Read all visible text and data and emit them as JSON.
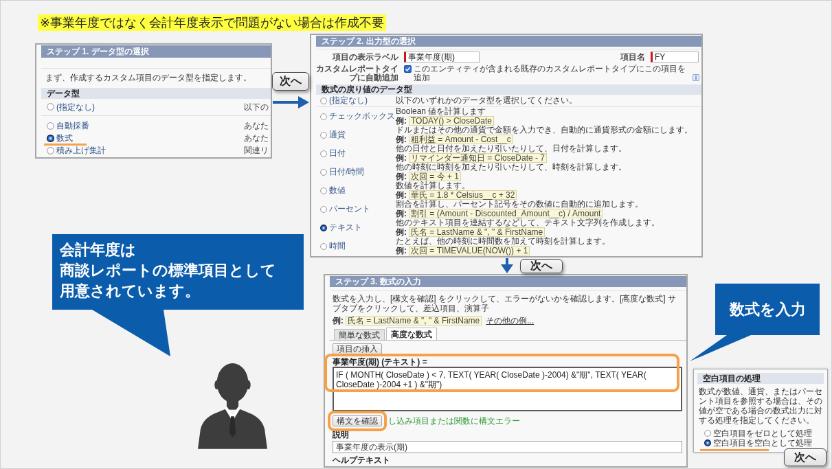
{
  "note": {
    "text": "※事業年度ではなく会計年度表示で問題がない場合は作成不要"
  },
  "step1": {
    "title": "ステップ 1. データ型の選択",
    "intro": "まず、作成するカスタム項目のデータ型を指定します。",
    "section": "データ型",
    "options": [
      {
        "label": "(指定なし)",
        "description": "以下の",
        "selected": false
      },
      {
        "label": "自動採番",
        "description": "あなた",
        "selected": false
      },
      {
        "label": "数式",
        "description": "あなた",
        "selected": true
      },
      {
        "label": "積み上げ集計",
        "description": "関連リ",
        "selected": false
      }
    ]
  },
  "step2": {
    "title": "ステップ 2. 出力型の選択",
    "fields": [
      {
        "label": "項目の表示ラベル",
        "value": "事業年度(期)"
      },
      {
        "label": "項目名",
        "value": "FY"
      }
    ],
    "auto_add": {
      "label": "カスタムレポートタイプに自動追加",
      "checked": true,
      "text": "このエンティティが含まれる既存のカスタムレポートタイプにこの項目を追加"
    },
    "section": "数式の戻り値のデータ型",
    "options": [
      {
        "label": "(指定なし)",
        "selected": false,
        "description": "以下のいずれかのデータ型を選択してください。"
      },
      {
        "label": "チェックボックス",
        "selected": false,
        "description": "Boolean 値を計算します",
        "example_label": "例:",
        "example": "TODAY() > CloseDate"
      },
      {
        "label": "通貨",
        "selected": false,
        "description": "ドルまたはその他の通貨で金額を入力でき、自動的に通貨形式の金額にします。",
        "example_label": "例:",
        "example": "粗利益 = Amount - Cost__c"
      },
      {
        "label": "日付",
        "selected": false,
        "description": "他の日付と日付を加えたり引いたりして、日付を計算します。",
        "example_label": "例:",
        "example": "リマインダー通知日 = CloseDate - 7"
      },
      {
        "label": "日付/時間",
        "selected": false,
        "description": "他の時刻に時刻を加えたり引いたりして、時刻を計算します。",
        "example_label": "例:",
        "example": "次回 = 今 + 1"
      },
      {
        "label": "数値",
        "selected": false,
        "description": "数値を計算します。",
        "example_label": "例:",
        "example": "華氏 = 1.8 * Celsius__c + 32"
      },
      {
        "label": "パーセント",
        "selected": false,
        "description": "割合を計算し、パーセント記号をその数値に自動的に追加します。",
        "example_label": "例:",
        "example": "割引 = (Amount - Discounted_Amount__c) / Amount"
      },
      {
        "label": "テキスト",
        "selected": true,
        "description": "他のテキスト項目を連結するなどして、テキスト文字列を作成します。",
        "example_label": "例:",
        "example": "氏名 = LastName & \", \" & FirstName"
      },
      {
        "label": "時間",
        "selected": false,
        "description": "たとえば、他の時刻に時間数を加えて時刻を計算します。",
        "example_label": "例:",
        "example": "次回 = TIMEVALUE(NOW()) + 1"
      }
    ]
  },
  "step3": {
    "title": "ステップ 3. 数式の入力",
    "intro": "数式を入力し、[構文を確認] をクリックして、エラーがないかを確認します。[高度な数式] サブタブをクリックして、差込項目、演算子",
    "example_label": "例:",
    "example": "氏名 = LastName & \", \" & FirstName",
    "more_link": "その他の例...",
    "tabs": [
      {
        "label": "簡単な数式",
        "selected": false
      },
      {
        "label": "高度な数式",
        "selected": true
      }
    ],
    "insert_button": "項目の挿入",
    "formula_label": "事業年度(期) (テキスト) =",
    "formula": "IF ( MONTH( CloseDate ) < 7, TEXT( YEAR( CloseDate )-2004) &\"期\", TEXT( YEAR( CloseDate )-2004 +1 ) &\"期\")",
    "check_button": "構文を確認",
    "check_message": "し込み項目または関数に構文エラー",
    "description_label": "説明",
    "description": "事業年度の表示(期)",
    "help_label": "ヘルプテキスト"
  },
  "blank_handling": {
    "title": "空白項目の処理",
    "text": "数式が数値、通貨、またはパーセント項目を参照する場合は、その値が空である場合の数式出力に対する処理を指定してください。",
    "options": [
      {
        "label": "空白項目をゼロとして処理",
        "selected": false
      },
      {
        "label": "空白項目を空白として処理",
        "selected": true
      }
    ]
  },
  "transitions": [
    {
      "kind": "right",
      "label": "次へ"
    },
    {
      "kind": "down",
      "label": "次へ"
    },
    {
      "kind": "none",
      "label": "次へ"
    }
  ],
  "callouts": [
    {
      "lines": [
        "会計年度は",
        "商談レポートの標準項目として",
        "用意されています。"
      ]
    },
    {
      "lines": [
        "数式を入力"
      ]
    }
  ]
}
